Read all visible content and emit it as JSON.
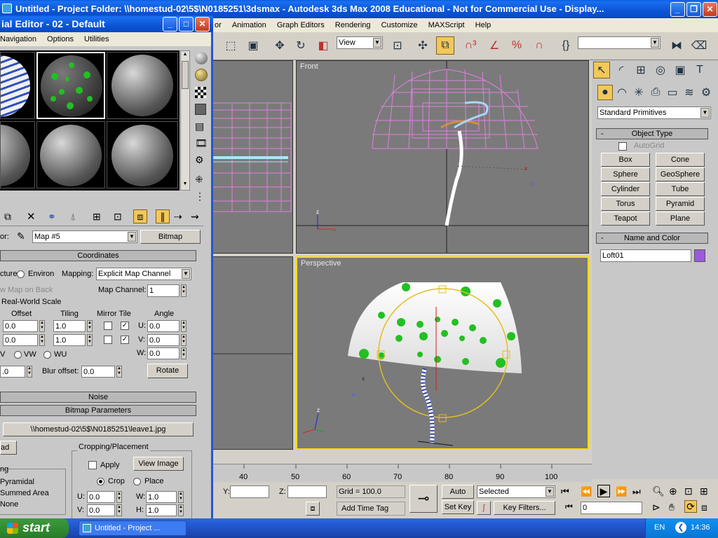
{
  "main_window": {
    "title": "Untitled      - Project Folder: \\\\homestud-02\\5$\\N0185251\\3dsmax      - Autodesk 3ds Max 2008   Educational - Not for Commercial Use    - Display...",
    "menu": [
      "or",
      "Animation",
      "Graph Editors",
      "Rendering",
      "Customize",
      "MAXScript",
      "Help"
    ],
    "view_dropdown": "View"
  },
  "material_editor": {
    "title": "ial Editor - 02 - Default",
    "menu": [
      "Navigation",
      "Options",
      "Utilities"
    ],
    "map_label": "or:",
    "map_name": "Map #5",
    "map_type": "Bitmap",
    "coordinates": {
      "title": "Coordinates",
      "texture_label": "cture",
      "environ_label": "Environ",
      "mapping_label": "Mapping:",
      "mapping_value": "Explicit Map Channel",
      "map_on_back": "w Map on Back",
      "map_channel_label": "Map Channel:",
      "map_channel_value": "1",
      "real_world": "Real-World Scale",
      "offset_label": "Offset",
      "tiling_label": "Tiling",
      "mirror_tile_label": "Mirror Tile",
      "angle_label": "Angle",
      "offset_u": "0.0",
      "offset_v": "0.0",
      "tiling_u": "1.0",
      "tiling_v": "1.0",
      "angle_u_label": "U:",
      "angle_v_label": "V:",
      "angle_w_label": "W:",
      "angle_u": "0.0",
      "angle_v": "0.0",
      "angle_w": "0.0",
      "uv_label": "V",
      "vw_label": "VW",
      "wu_label": "WU",
      "blur_value": ".0",
      "blur_offset_label": "Blur offset:",
      "blur_offset_value": "0.0",
      "rotate_label": "Rotate"
    },
    "noise_title": "Noise",
    "bitmap_params": {
      "title": "Bitmap Parameters",
      "path": "\\\\homestud-02\\5$\\N0185251\\leave1.jpg",
      "reload_label": "ad",
      "cropping_title": "Cropping/Placement",
      "apply_label": "Apply",
      "view_image_label": "View Image",
      "crop_label": "Crop",
      "place_label": "Place",
      "u_label": "U:",
      "v_label": "V:",
      "w_label": "W:",
      "h_label": "H:",
      "u_value": "0.0",
      "v_value": "0.0",
      "w_value": "1.0",
      "h_value": "1.0",
      "filter_items": [
        "ng",
        "Pyramidal",
        "Summed Area",
        "None"
      ]
    }
  },
  "viewports": {
    "front_label": "Front",
    "perspective_label": "Perspective"
  },
  "command_panel": {
    "category_dropdown": "Standard Primitives",
    "object_type_title": "Object Type",
    "autogrid_label": "AutoGrid",
    "buttons": [
      "Box",
      "Cone",
      "Sphere",
      "GeoSphere",
      "Cylinder",
      "Tube",
      "Torus",
      "Pyramid",
      "Teapot",
      "Plane"
    ],
    "name_color_title": "Name and Color",
    "object_name": "Loft01",
    "object_color": "#9b59e0"
  },
  "timeline": {
    "ticks": [
      "40",
      "50",
      "60",
      "70",
      "80",
      "90",
      "100"
    ]
  },
  "status": {
    "y_label": "Y:",
    "z_label": "Z:",
    "grid_text": "Grid = 100.0",
    "add_time_tag": "Add Time Tag",
    "auto_key": "Auto Key",
    "set_key": "Set Key",
    "selected_value": "Selected",
    "key_filters": "Key Filters...",
    "frame_value": "0"
  },
  "taskbar": {
    "start_label": "start",
    "task_item": "Untitled    - Project ...",
    "language": "EN",
    "clock": "14:36"
  },
  "colors": {
    "active_viewport": "#f5e000",
    "wireframe_pink": "#e080e0",
    "xp_blue": "#245edb"
  }
}
